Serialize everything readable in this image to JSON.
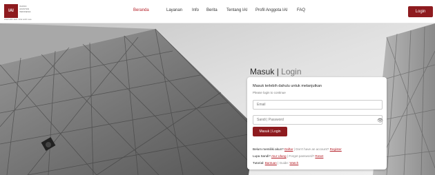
{
  "nav": {
    "logo_text": [
      "IKATAN",
      "AKUNTAN",
      "INDONESIA"
    ],
    "logo_tagline": "Lihat Lebih Jauh. Lihat Lebih Luas.",
    "menu": [
      {
        "label": "Beranda",
        "active": true
      },
      {
        "label": "Layanan",
        "active": false
      },
      {
        "label": "Info",
        "active": false
      },
      {
        "label": "Berita",
        "active": false
      },
      {
        "label": "Tentang IAI",
        "active": false
      },
      {
        "label": "Profil Anggota IAI",
        "active": false
      },
      {
        "label": "FAQ",
        "active": false
      }
    ],
    "login_label": "Login"
  },
  "login": {
    "heading_id": "Masuk",
    "heading_sep": "|",
    "heading_en": "Login",
    "intro": "Masuk terlebih dahulu untuk melanjutkan",
    "intro_en": "Please login to continue",
    "email_placeholder": "Email",
    "password_placeholder": "Sandi | Password",
    "submit_label": "Masuk | Login",
    "register_prefix": "Belum memiliki akun?",
    "register_link": "Daftar",
    "register_en": "| Don't have an account?",
    "register_link_en": "Register",
    "forgot_prefix": "Lupa Sandi?",
    "forgot_link": "Atur Ulang",
    "forgot_en": "| Forgot password?",
    "forgot_link_en": "Reset",
    "tutorial_prefix": "Tutorial:",
    "tutorial_link": "Bantuan",
    "tutorial_en": "| Guide:",
    "tutorial_link_en": "Watch"
  },
  "colors": {
    "brand": "#8e1b1f",
    "link": "#b31b24"
  },
  "icons": {
    "password_toggle": "eye-icon"
  }
}
